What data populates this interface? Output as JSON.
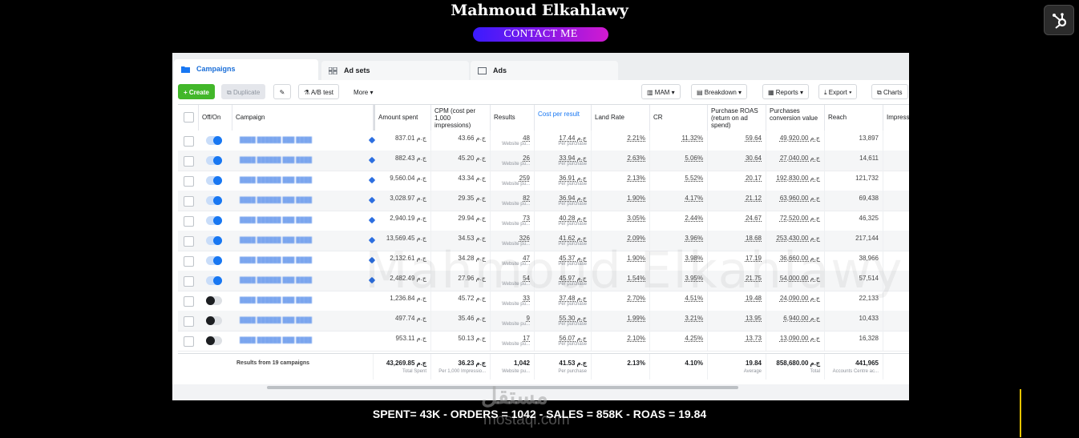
{
  "header": {
    "name": "Mahmoud Elkahlawy",
    "contact_label": "CONTACT ME"
  },
  "tabs": [
    {
      "label": "Campaigns",
      "active": true
    },
    {
      "label": "Ad sets",
      "active": false
    },
    {
      "label": "Ads",
      "active": false
    }
  ],
  "toolbar": {
    "create": "Create",
    "duplicate": "Duplicate",
    "ab_test": "A/B test",
    "more": "More",
    "mam": "MAM",
    "breakdown": "Breakdown",
    "reports": "Reports",
    "export": "Export",
    "charts": "Charts"
  },
  "columns": {
    "offon": "Off/On",
    "campaign": "Campaign",
    "amount": "Amount spent",
    "cpm": "CPM (cost per 1,000 impressions)",
    "results": "Results",
    "cost": "Cost per result",
    "land": "Land Rate",
    "cr": "CR",
    "roas": "Purchase ROAS (return on ad spend)",
    "pcv": "Purchases conversion value",
    "reach": "Reach",
    "impress": "Impress"
  },
  "rows": [
    {
      "on": true,
      "amount": "837.01 ج.م",
      "cpm": "43.66 ج.م",
      "results": "48",
      "cost": "17.44 ج.م",
      "land": "2.21%",
      "cr": "11.32%",
      "roas": "59.64",
      "pcv": "49,920.00 ج.م",
      "reach": "13,897"
    },
    {
      "on": true,
      "amount": "882.43 ج.م",
      "cpm": "45.20 ج.م",
      "results": "26",
      "cost": "33.94 ج.م",
      "land": "2.63%",
      "cr": "5.06%",
      "roas": "30.64",
      "pcv": "27,040.00 ج.م",
      "reach": "14,611"
    },
    {
      "on": true,
      "amount": "9,560.04 ج.م",
      "cpm": "43.34 ج.م",
      "results": "259",
      "cost": "36.91 ج.م",
      "land": "2.13%",
      "cr": "5.52%",
      "roas": "20.17",
      "pcv": "192,830.00 ج.م",
      "reach": "121,732"
    },
    {
      "on": true,
      "amount": "3,028.97 ج.م",
      "cpm": "29.35 ج.م",
      "results": "82",
      "cost": "36.94 ج.م",
      "land": "1.90%",
      "cr": "4.17%",
      "roas": "21.12",
      "pcv": "63,960.00 ج.م",
      "reach": "69,438"
    },
    {
      "on": true,
      "amount": "2,940.19 ج.م",
      "cpm": "29.94 ج.م",
      "results": "73",
      "cost": "40.28 ج.م",
      "land": "3.05%",
      "cr": "2.44%",
      "roas": "24.67",
      "pcv": "72,520.00 ج.م",
      "reach": "46,325"
    },
    {
      "on": true,
      "amount": "13,569.45 ج.م",
      "cpm": "34.53 ج.م",
      "results": "326",
      "cost": "41.62 ج.م",
      "land": "2.09%",
      "cr": "3.96%",
      "roas": "18.68",
      "pcv": "253,430.00 ج.م",
      "reach": "217,144"
    },
    {
      "on": true,
      "amount": "2,132.61 ج.م",
      "cpm": "34.28 ج.م",
      "results": "47",
      "cost": "45.37 ج.م",
      "land": "1.90%",
      "cr": "3.98%",
      "roas": "17.19",
      "pcv": "36,660.00 ج.م",
      "reach": "38,966"
    },
    {
      "on": true,
      "amount": "2,482.49 ج.م",
      "cpm": "27.96 ج.م",
      "results": "54",
      "cost": "45.97 ج.م",
      "land": "1.54%",
      "cr": "3.95%",
      "roas": "21.75",
      "pcv": "54,000.00 ج.م",
      "reach": "57,514"
    },
    {
      "on": false,
      "amount": "1,236.84 ج.م",
      "cpm": "45.72 ج.م",
      "results": "33",
      "cost": "37.48 ج.م",
      "land": "2.70%",
      "cr": "4.51%",
      "roas": "19.48",
      "pcv": "24,090.00 ج.م",
      "reach": "22,133"
    },
    {
      "on": false,
      "amount": "497.74 ج.م",
      "cpm": "35.46 ج.م",
      "results": "9",
      "cost": "55.30 ج.م",
      "land": "1.99%",
      "cr": "3.21%",
      "roas": "13.95",
      "pcv": "6,940.00 ج.م",
      "reach": "10,433"
    },
    {
      "on": false,
      "amount": "953.11 ج.م",
      "cpm": "50.13 ج.م",
      "results": "17",
      "cost": "56.07 ج.م",
      "land": "2.10%",
      "cr": "4.25%",
      "roas": "13.73",
      "pcv": "13,090.00 ج.م",
      "reach": "16,328"
    }
  ],
  "sublabels": {
    "results": "Website pu...",
    "cost": "Per purchase"
  },
  "footer": {
    "label": "Results from 19 campaigns",
    "amount": "43,269.85 ج.م",
    "amount_sub": "Total Spent",
    "cpm": "36.23 ج.م",
    "cpm_sub": "Per 1,000 Impressio...",
    "results": "1,042",
    "results_sub": "Website pu...",
    "cost": "41.53 ج.م",
    "cost_sub": "Per purchase",
    "land": "2.13%",
    "cr": "4.10%",
    "roas": "19.84",
    "roas_sub": "Average",
    "pcv": "858,680.00 ج.م",
    "pcv_sub": "Total",
    "reach": "441,965",
    "reach_sub": "Accounts Centre ac..."
  },
  "watermark": "Mahmoud Elkahlawy",
  "summary": "SPENT= 43K - ORDERS = 1042 - SALES = 858K - ROAS = 19.84",
  "site_watermark": {
    "arabic": "مستقل",
    "latin": "mostaql.com"
  }
}
